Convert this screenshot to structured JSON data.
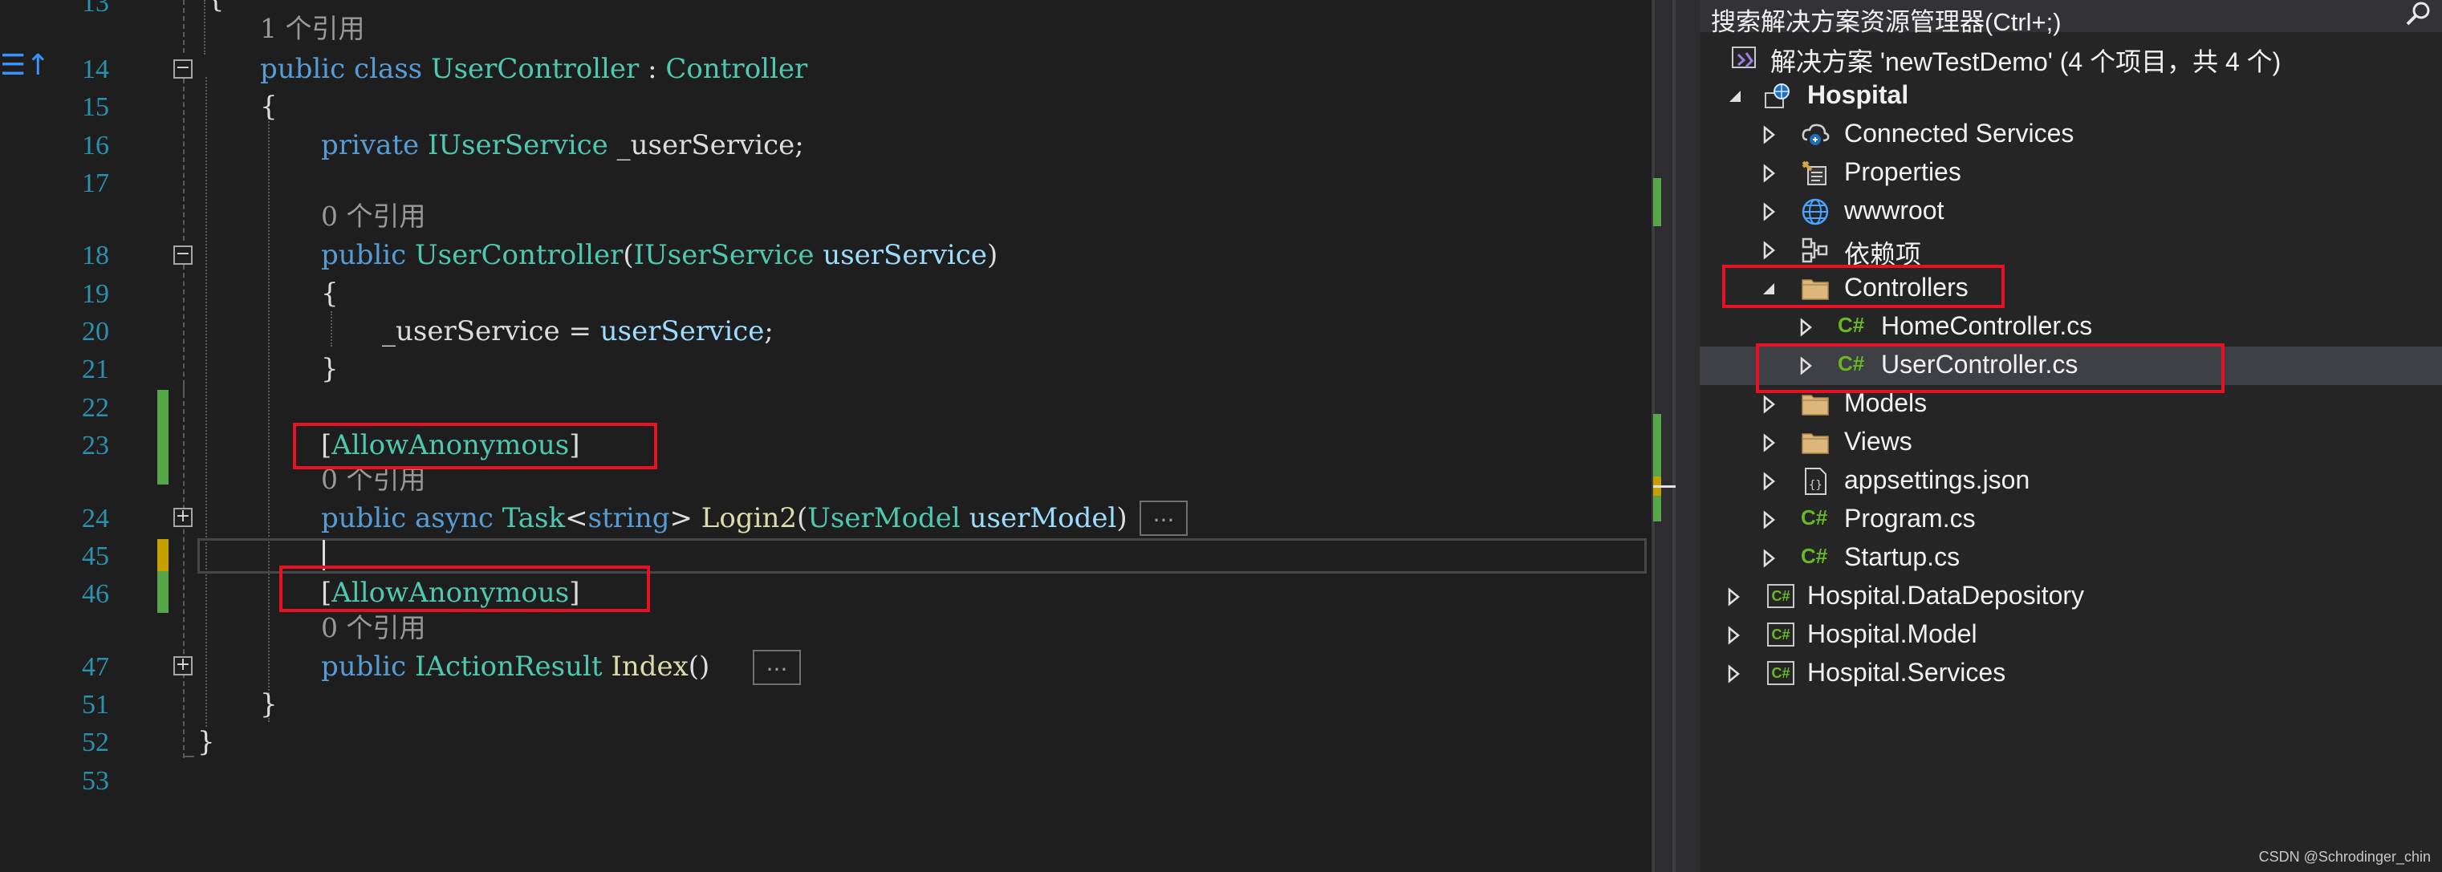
{
  "editor": {
    "line_numbers": [
      "13",
      "14",
      "15",
      "16",
      "17",
      "18",
      "19",
      "20",
      "21",
      "22",
      "23",
      "24",
      "45",
      "46",
      "47",
      "51",
      "52",
      "53"
    ],
    "lens": {
      "one_ref": "1 个引用",
      "zero_ref_a": "0 个引用",
      "zero_ref_b": "0 个引用",
      "zero_ref_c": "0 个引用"
    },
    "line14": {
      "kw1": "public",
      "kw2": "class",
      "cls": "UserController",
      "colon": " : ",
      "base": "Controller"
    },
    "line15": "{",
    "line16": {
      "kw": "private",
      "ty": "IUserService",
      "id": " _userService;"
    },
    "line18": {
      "kw": "public",
      "ctor": "UserController",
      "open": "(",
      "ty": "IUserService",
      "param": "userService",
      "close": ")"
    },
    "line19": "{",
    "line20": {
      "field": "_userService = ",
      "val": "userService",
      "end": ";"
    },
    "line21": "}",
    "line23": {
      "open": "[",
      "attr": "AllowAnonymous",
      "close": "]"
    },
    "line24": {
      "kw1": "public",
      "kw2": "async",
      "task": "Task",
      "lt": "<",
      "str": "string",
      "gt": ">",
      "fn": "Login2",
      "open": "(",
      "ty": "UserModel",
      "param": "userModel",
      "close": ")",
      "collapsed": "..."
    },
    "line46": {
      "open": "[",
      "attr": "AllowAnonymous",
      "close": "]"
    },
    "line47": {
      "kw": "public",
      "ty": "IActionResult",
      "fn": "Index",
      "parens": "()",
      "collapsed": "..."
    },
    "line51": "}",
    "line52": "}",
    "left_marker": "☰↑"
  },
  "explorer": {
    "search_label": "搜索解决方案资源管理器(Ctrl+;)",
    "solution": "解决方案 'newTestDemo' (4 个项目，共 4 个)",
    "items": [
      {
        "label": "Hospital",
        "icon": "web-project-icon"
      },
      {
        "label": "Connected Services",
        "icon": "connected-services-icon"
      },
      {
        "label": "Properties",
        "icon": "properties-icon"
      },
      {
        "label": "wwwroot",
        "icon": "globe-icon"
      },
      {
        "label": "依赖项",
        "icon": "dependencies-icon"
      },
      {
        "label": "Controllers",
        "icon": "folder-icon"
      },
      {
        "label": "HomeController.cs",
        "icon": "csharp-file-icon"
      },
      {
        "label": "UserController.cs",
        "icon": "csharp-file-icon"
      },
      {
        "label": "Models",
        "icon": "folder-icon"
      },
      {
        "label": "Views",
        "icon": "folder-icon"
      },
      {
        "label": "appsettings.json",
        "icon": "json-file-icon"
      },
      {
        "label": "Program.cs",
        "icon": "csharp-file-icon"
      },
      {
        "label": "Startup.cs",
        "icon": "csharp-file-icon"
      },
      {
        "label": "Hospital.DataDepository",
        "icon": "csharp-project-icon"
      },
      {
        "label": "Hospital.Model",
        "icon": "csharp-project-icon"
      },
      {
        "label": "Hospital.Services",
        "icon": "csharp-project-icon"
      }
    ],
    "cs_glyph": "C#"
  },
  "watermark": "CSDN @Schrodinger_chin",
  "colors": {
    "keyword": "#569cd6",
    "type": "#4ec9b0",
    "identifier": "#9cdcfe",
    "method": "#dcdcaa",
    "highlight": "#e81123",
    "changed": "#57a64a"
  }
}
